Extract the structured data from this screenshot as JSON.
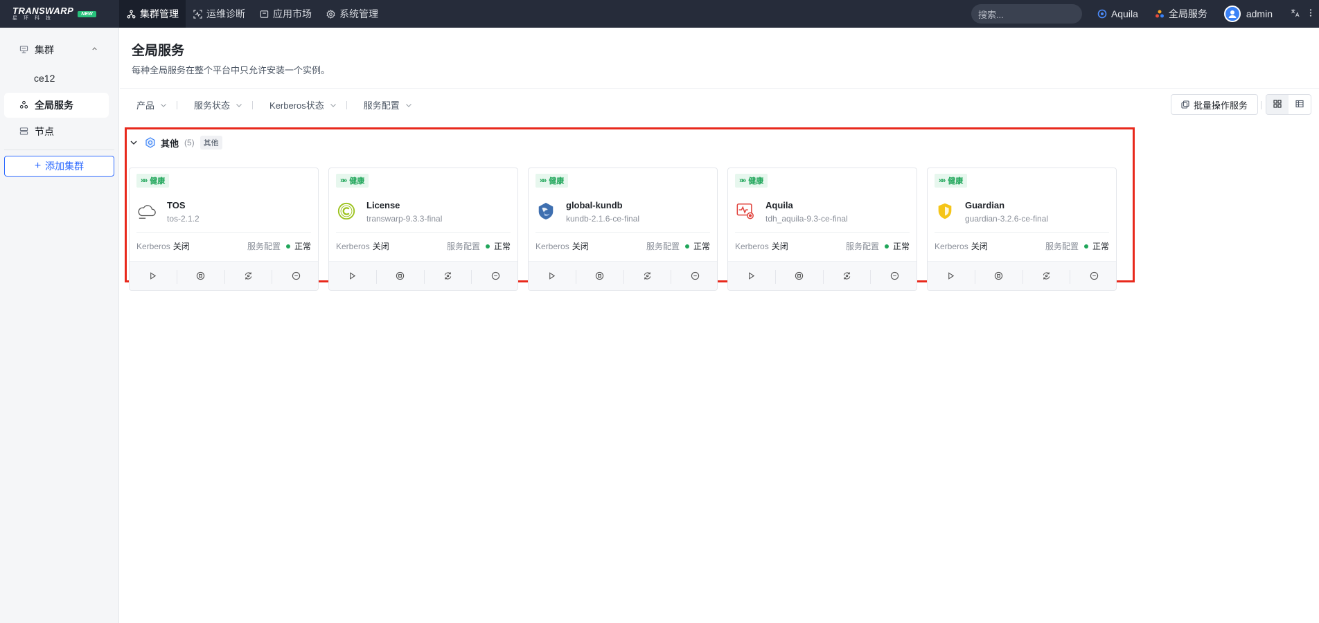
{
  "topbar": {
    "logo_text": "TRANSWARP",
    "logo_sub": "星环科技",
    "logo_badge": "NEW",
    "nav": [
      {
        "label": "集群管理",
        "icon": "cluster-icon",
        "active": true
      },
      {
        "label": "运维诊断",
        "icon": "diagnose-icon",
        "active": false
      },
      {
        "label": "应用市场",
        "icon": "market-icon",
        "active": false
      },
      {
        "label": "系统管理",
        "icon": "gear-icon",
        "active": false
      }
    ],
    "search_placeholder": "搜索...",
    "aquila_label": "Aquila",
    "global_services_label": "全局服务",
    "user_label": "admin"
  },
  "sidebar": {
    "group_label": "集群",
    "cluster_item": "ce12",
    "global_services": "全局服务",
    "nodes": "节点",
    "add_cluster": "添加集群"
  },
  "main": {
    "title": "全局服务",
    "description": "每种全局服务在整个平台中只允许安装一个实例。",
    "filters": [
      "产品",
      "服务状态",
      "Kerberos状态",
      "服务配置"
    ],
    "batch_button": "批量操作服务",
    "group": {
      "name": "其他",
      "count": "(5)",
      "tag": "其他"
    },
    "cards": [
      {
        "status": "健康",
        "name": "TOS",
        "version": "tos-2.1.2",
        "icon": "cloud-icon",
        "kerberos_label": "Kerberos",
        "kerberos_value": "关闭",
        "config_label": "服务配置",
        "config_value": "正常"
      },
      {
        "status": "健康",
        "name": "License",
        "version": "transwarp-9.3.3-final",
        "icon": "license-icon",
        "kerberos_label": "Kerberos",
        "kerberos_value": "关闭",
        "config_label": "服务配置",
        "config_value": "正常"
      },
      {
        "status": "健康",
        "name": "global-kundb",
        "version": "kundb-2.1.6-ce-final",
        "icon": "kundb-icon",
        "kerberos_label": "Kerberos",
        "kerberos_value": "关闭",
        "config_label": "服务配置",
        "config_value": "正常"
      },
      {
        "status": "健康",
        "name": "Aquila",
        "version": "tdh_aquila-9.3-ce-final",
        "icon": "monitor-icon",
        "kerberos_label": "Kerberos",
        "kerberos_value": "关闭",
        "config_label": "服务配置",
        "config_value": "正常"
      },
      {
        "status": "健康",
        "name": "Guardian",
        "version": "guardian-3.2.6-ce-final",
        "icon": "shield-icon",
        "kerberos_label": "Kerberos",
        "kerberos_value": "关闭",
        "config_label": "服务配置",
        "config_value": "正常"
      }
    ]
  },
  "colors": {
    "topbar": "#262c3a",
    "accent": "#2f6bff",
    "healthy": "#20a65a",
    "highlight": "#e8291c"
  }
}
